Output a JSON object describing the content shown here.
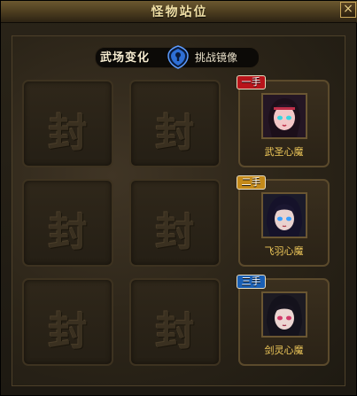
{
  "window": {
    "title": "怪物站位",
    "close_glyph": "×"
  },
  "mode": {
    "label": "武场变化",
    "value": "挑战镜像",
    "icon": "blue-lock-icon"
  },
  "empty_slot_glyph": "封",
  "characters": [
    {
      "badge": "一手",
      "badge_color": "#b8141a",
      "name": "武圣心魔"
    },
    {
      "badge": "二手",
      "badge_color": "#c48a1a",
      "name": "飞羽心魔"
    },
    {
      "badge": "三手",
      "badge_color": "#1a5fb4",
      "name": "剑灵心魔"
    }
  ],
  "colors": {
    "accent_gold": "#f0c95a",
    "title_text": "#f3e2a7",
    "lock_blue": "#2e6fd6"
  }
}
